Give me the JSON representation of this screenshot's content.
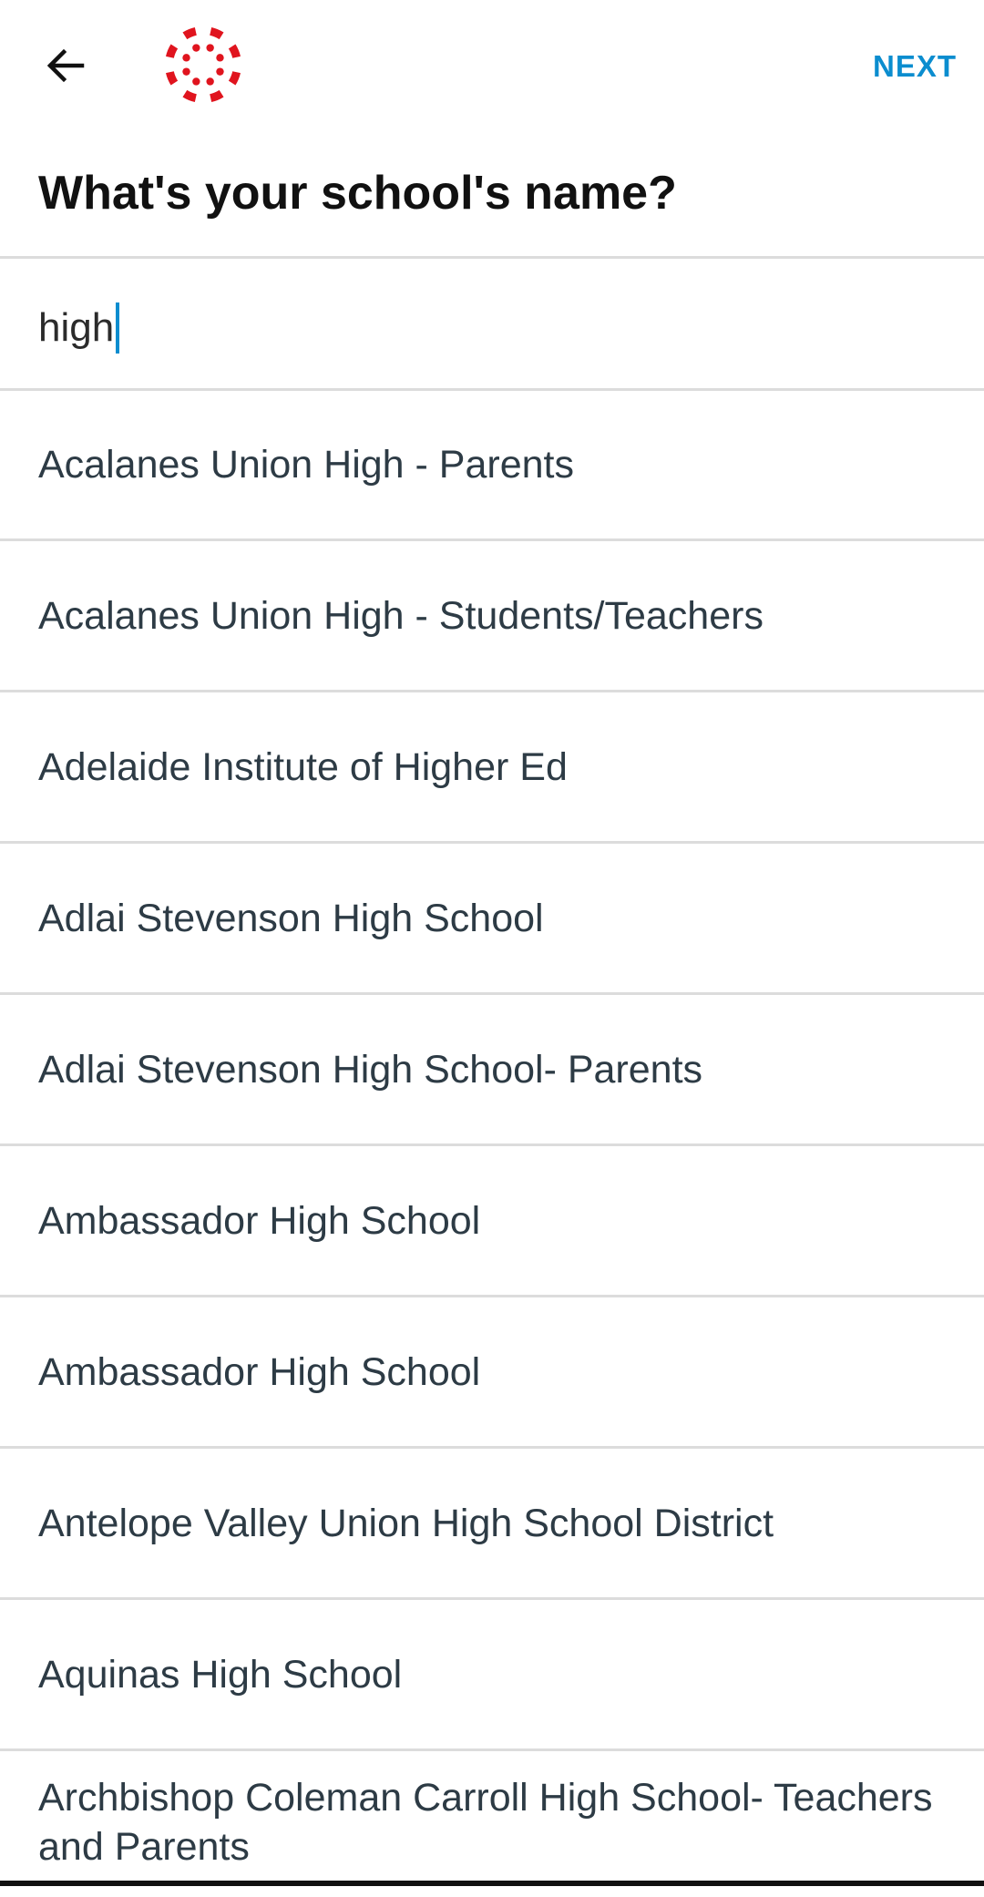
{
  "topbar": {
    "back_icon": "arrow-left-icon",
    "logo_icon": "canvas-logo-icon",
    "next_label": "NEXT",
    "accent_color": "#0b8dcf",
    "logo_color": "#e0141e"
  },
  "title": "What's your school's name?",
  "search": {
    "value": "high"
  },
  "results": [
    "Acalanes Union High - Parents",
    "Acalanes Union High - Students/Teachers",
    "Adelaide Institute of Higher Ed",
    "Adlai Stevenson High School",
    "Adlai Stevenson High School- Parents",
    "Ambassador High School",
    "Ambassador High School",
    "Antelope Valley Union High School District",
    "Aquinas High School",
    "Archbishop Coleman Carroll High School- Teachers and Parents"
  ]
}
